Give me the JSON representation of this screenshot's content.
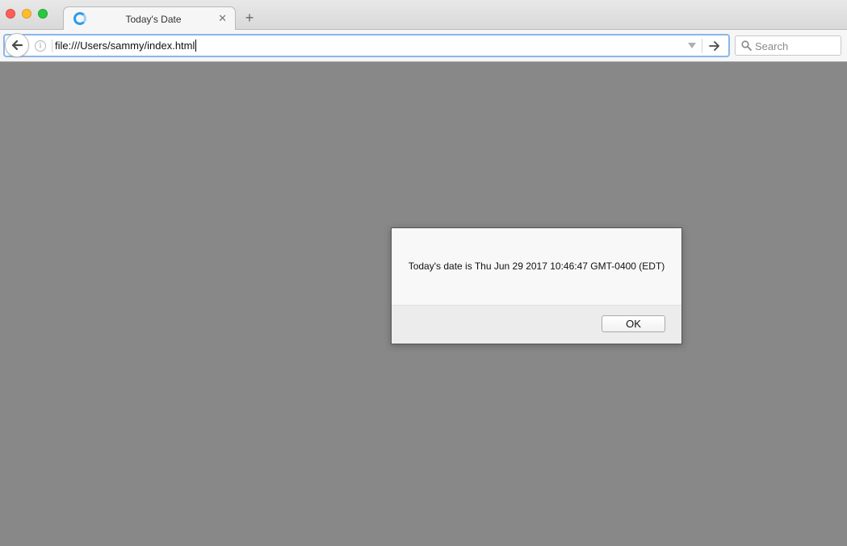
{
  "tab": {
    "title": "Today's Date",
    "close_glyph": "✕",
    "favicon": "globe-icon"
  },
  "new_tab": {
    "glyph": "+"
  },
  "navbar": {
    "url": "file:///Users/sammy/index.html",
    "info_glyph": "i",
    "search": {
      "placeholder": "Search"
    }
  },
  "dialog": {
    "message": "Today's date is Thu Jun 29 2017 10:46:47 GMT-0400 (EDT)",
    "ok_label": "OK"
  },
  "colors": {
    "page_background": "#888888",
    "urlbar_focus": "#8ab6ea",
    "traffic_red": "#fc5f57",
    "traffic_yellow": "#fdbc2e",
    "traffic_green": "#28c840"
  }
}
